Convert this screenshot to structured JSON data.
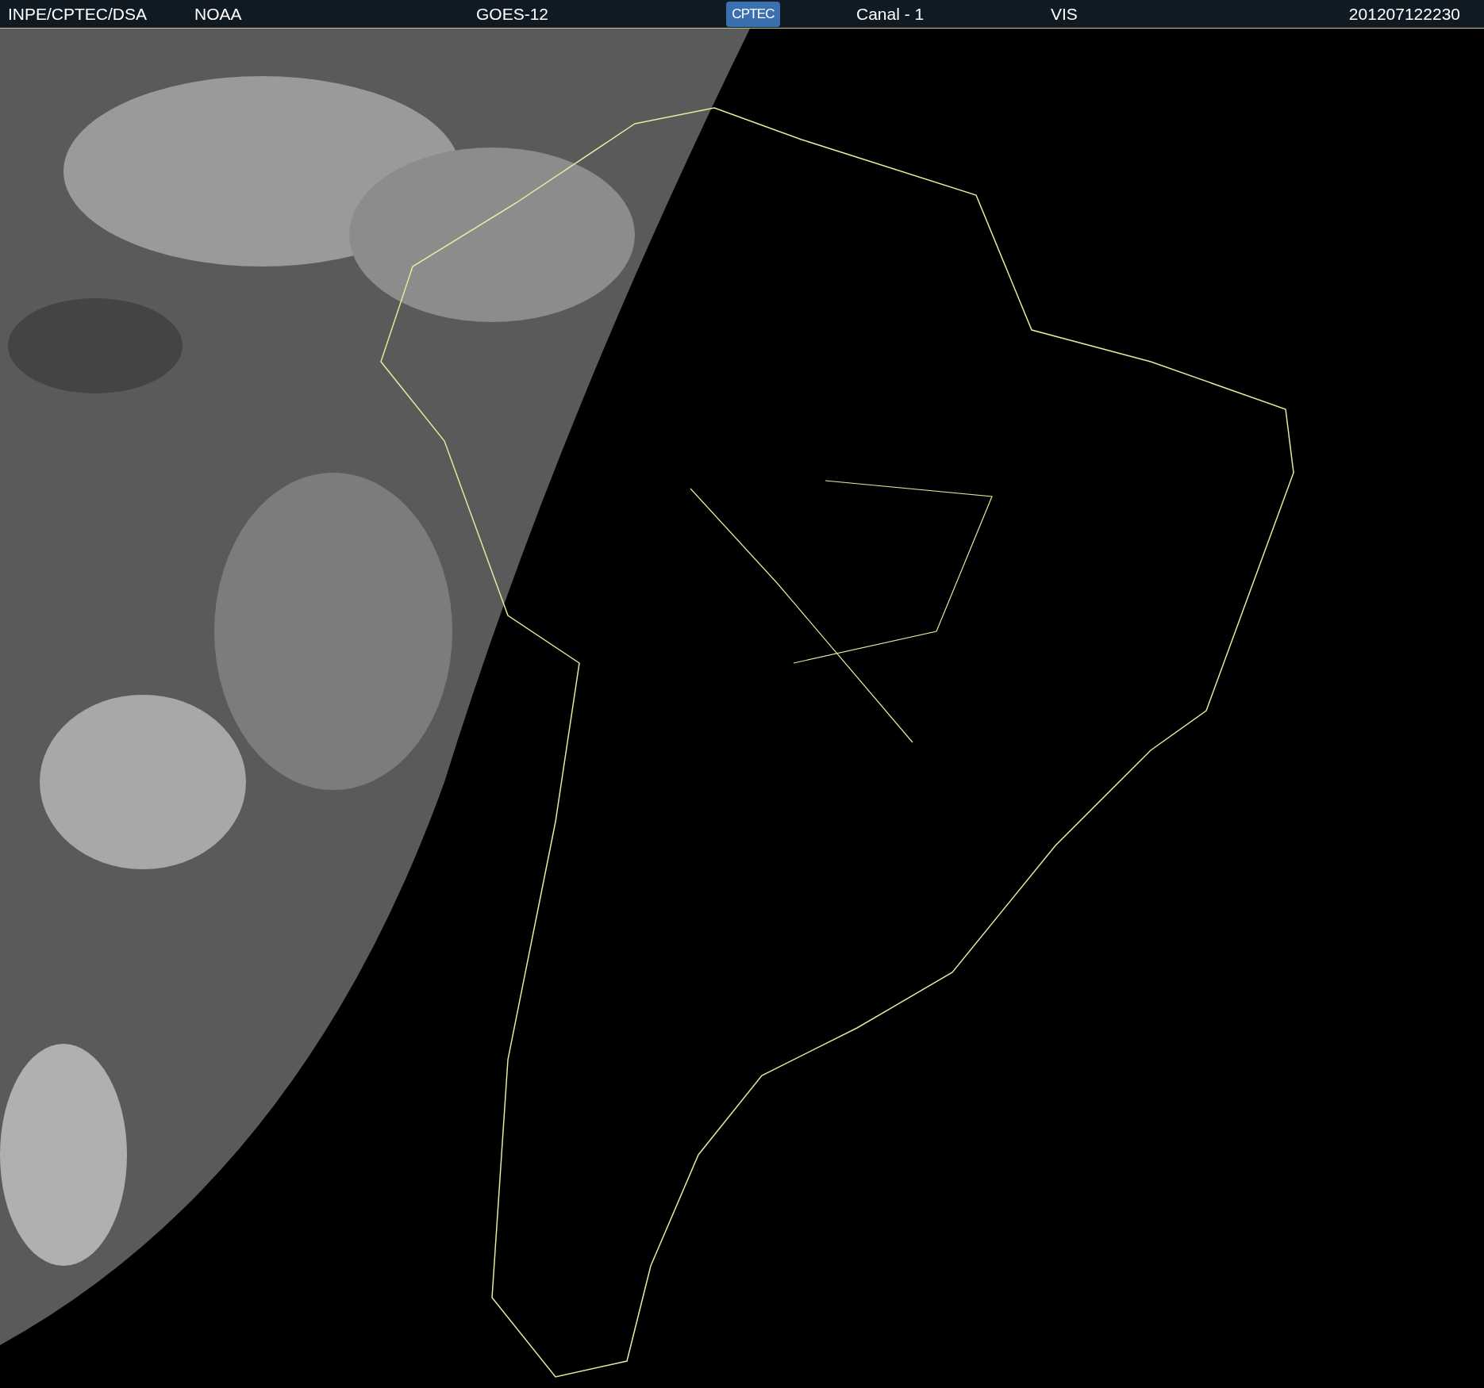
{
  "header": {
    "source": "INPE/CPTEC/DSA",
    "agency": "NOAA",
    "satellite": "GOES-12",
    "logo": "CPTEC",
    "channel": "Canal - 1",
    "band": "VIS",
    "timestamp": "201207122230"
  }
}
